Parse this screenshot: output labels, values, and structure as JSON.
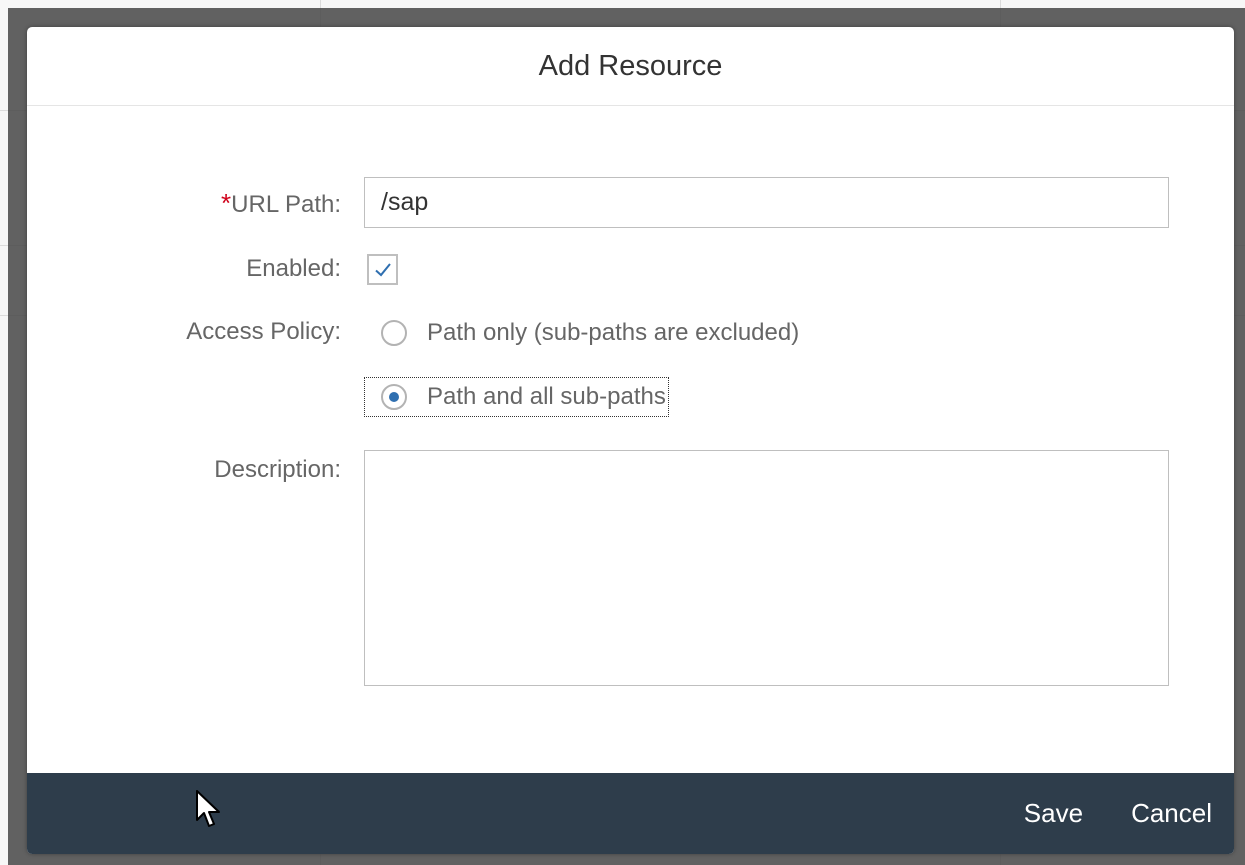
{
  "dialog": {
    "title": "Add Resource",
    "url_path": {
      "label": "URL Path:",
      "required_marker": "*",
      "value": "/sap"
    },
    "enabled": {
      "label": "Enabled:",
      "checked": true
    },
    "access_policy": {
      "label": "Access Policy:",
      "options": [
        {
          "label": "Path only (sub-paths are excluded)",
          "selected": false
        },
        {
          "label": "Path and all sub-paths",
          "selected": true
        }
      ]
    },
    "description": {
      "label": "Description:",
      "value": ""
    },
    "footer": {
      "save_label": "Save",
      "cancel_label": "Cancel"
    }
  },
  "colors": {
    "footer_bg": "#2e3d4b",
    "required": "#d0021b",
    "radio_selected": "#2f6fb0",
    "checkmark": "#2f6fb0"
  },
  "icons": [
    "check-icon",
    "mouse-cursor-icon"
  ]
}
